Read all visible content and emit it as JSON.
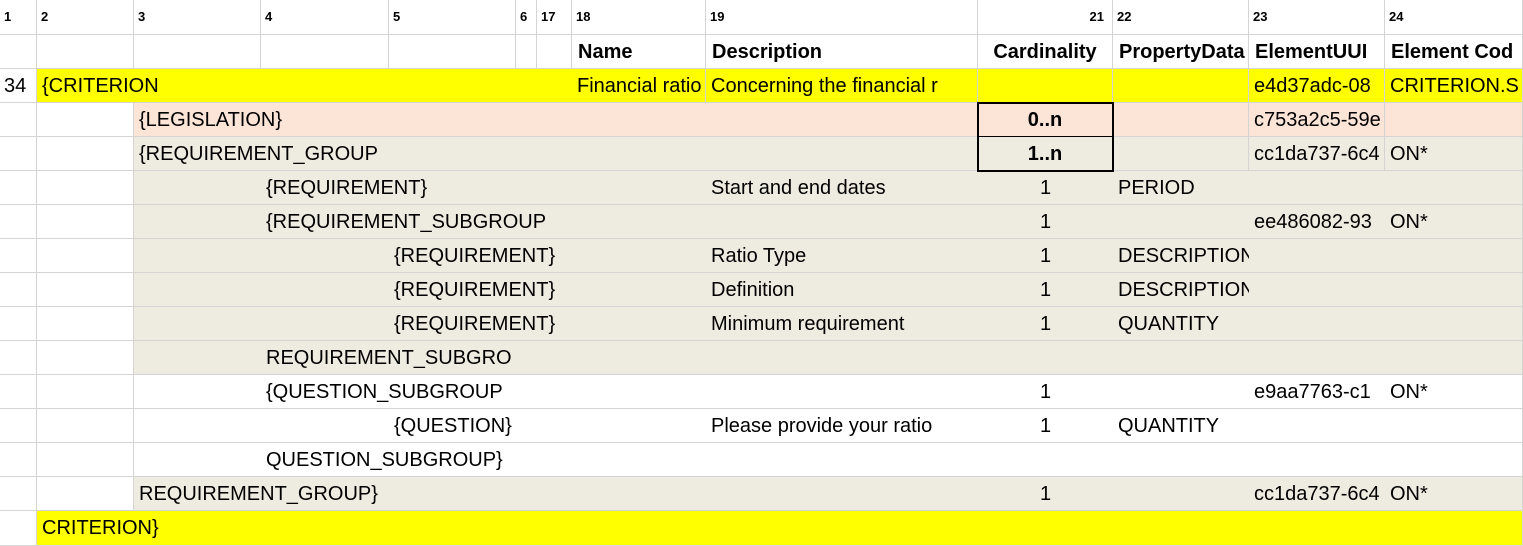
{
  "column_indices": [
    "1",
    "2",
    "3",
    "4",
    "5",
    "6",
    "17",
    "18",
    "19",
    "21",
    "22",
    "23",
    "24"
  ],
  "header": {
    "name": "Name",
    "description": "Description",
    "cardinality": "Cardinality",
    "property_data": "PropertyData",
    "element_uuid": "ElementUUI",
    "element_code": "Element Cod"
  },
  "rows": [
    {
      "rownum": "34",
      "c2": "{CRITERION",
      "name": "Financial ratio",
      "description": "Concerning the financial r",
      "element_uuid": "e4d37adc-08",
      "element_code": "CRITERION.S"
    },
    {
      "c3": "{LEGISLATION}",
      "cardinality": "0..n",
      "element_uuid": "c753a2c5-59e"
    },
    {
      "c3": "{REQUIREMENT_GROUP",
      "cardinality": "1..n",
      "element_uuid": "cc1da737-6c4",
      "element_code": "ON*"
    },
    {
      "c4": "{REQUIREMENT}",
      "description": "Start and end dates",
      "cardinality": "1",
      "property_data": "PERIOD"
    },
    {
      "c4": "{REQUIREMENT_SUBGROUP",
      "cardinality": "1",
      "element_uuid": "ee486082-93",
      "element_code": "ON*"
    },
    {
      "c5": "{REQUIREMENT}",
      "description": "Ratio Type",
      "cardinality": "1",
      "property_data": "DESCRIPTION"
    },
    {
      "c5": "{REQUIREMENT}",
      "description": "Definition",
      "cardinality": "1",
      "property_data": "DESCRIPTION"
    },
    {
      "c5": "{REQUIREMENT}",
      "description": "Minimum requirement",
      "cardinality": "1",
      "property_data": "QUANTITY"
    },
    {
      "c4": "REQUIREMENT_SUBGRO"
    },
    {
      "c4": "{QUESTION_SUBGROUP",
      "cardinality": "1",
      "element_uuid": "e9aa7763-c1",
      "element_code": "ON*"
    },
    {
      "c5": "{QUESTION}",
      "description": "Please provide your ratio",
      "cardinality": "1",
      "property_data": "QUANTITY"
    },
    {
      "c4": "QUESTION_SUBGROUP}"
    },
    {
      "c3": "REQUIREMENT_GROUP}",
      "cardinality": "1",
      "element_uuid": "cc1da737-6c4",
      "element_code": "ON*"
    },
    {
      "c2": "CRITERION}"
    }
  ],
  "colors": {
    "yellow": "#ffff00",
    "peach": "#fce4d6",
    "beige": "#eeece1",
    "white": "#ffffff",
    "gridline": "#d4d4d4"
  }
}
